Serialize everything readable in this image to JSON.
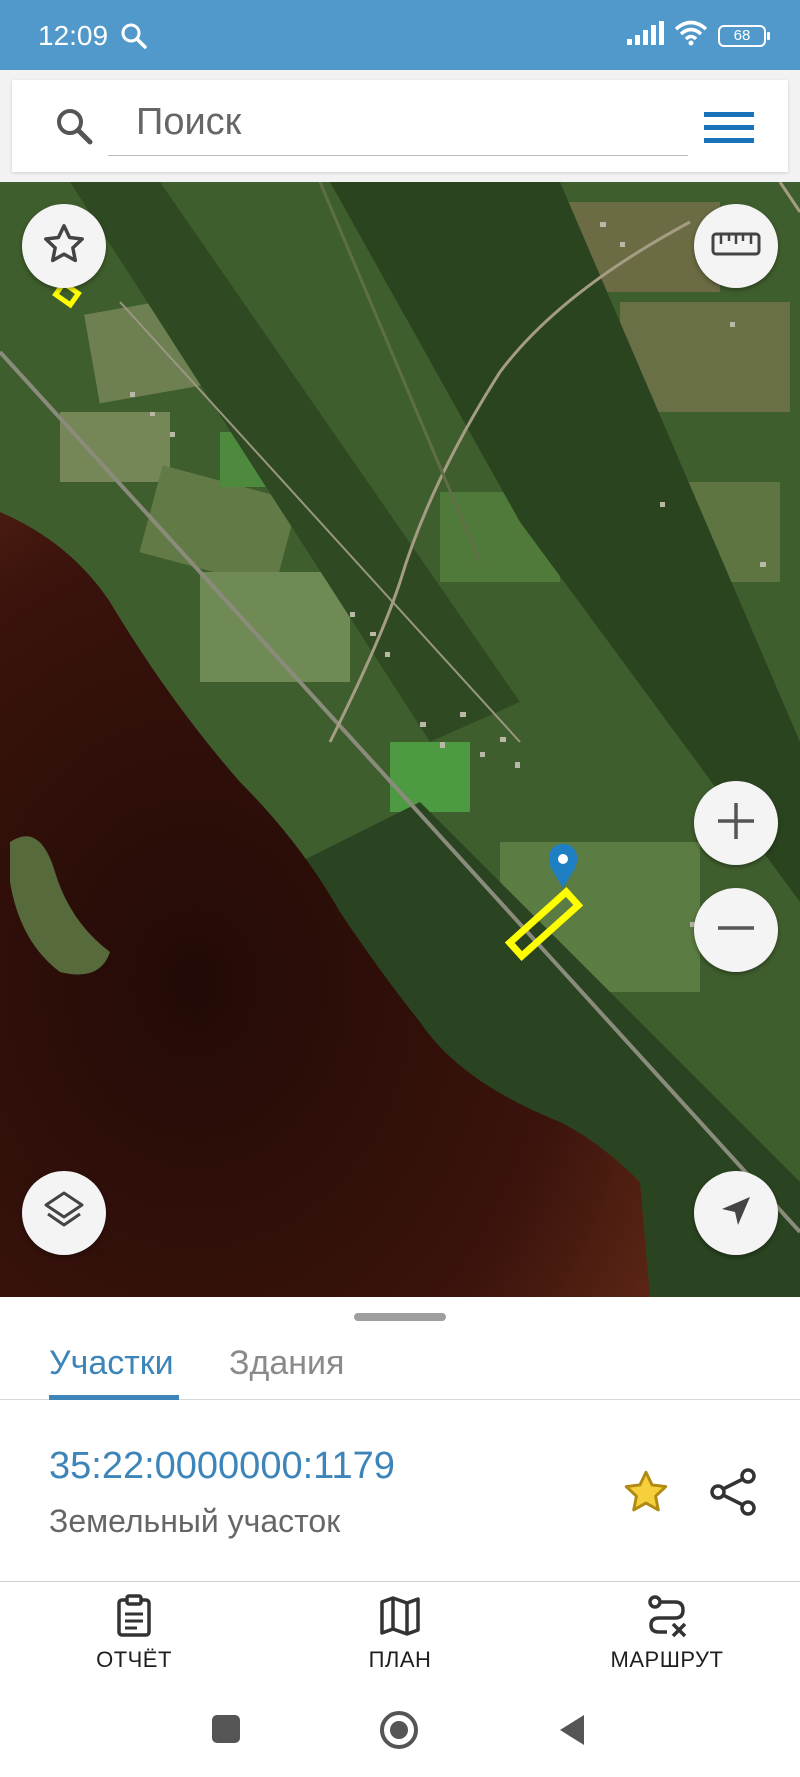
{
  "status_bar": {
    "time": "12:09",
    "battery": "68",
    "icons": [
      "search-icon",
      "signal-icon",
      "wifi-icon",
      "battery-icon"
    ]
  },
  "search": {
    "placeholder": "Поиск",
    "icons": [
      "search-icon",
      "menu-icon"
    ]
  },
  "map": {
    "controls": [
      "favorites-star-icon",
      "ruler-icon",
      "zoom-in-icon",
      "zoom-out-icon",
      "layers-icon",
      "locate-arrow-icon"
    ],
    "highlight_color": "#ffff00",
    "marker_color": "#1e7fc2"
  },
  "sheet": {
    "tabs": [
      {
        "label": "Участки",
        "active": true
      },
      {
        "label": "Здания",
        "active": false
      }
    ],
    "parcel": {
      "id": "35:22:0000000:1179",
      "type": "Земельный участок"
    },
    "accent_color": "#3d85b8",
    "star_color": "#d8b21a"
  },
  "actions": [
    {
      "label": "ОТЧЁТ",
      "icon": "report-clipboard-icon"
    },
    {
      "label": "ПЛАН",
      "icon": "map-plan-icon"
    },
    {
      "label": "МАРШРУТ",
      "icon": "route-icon"
    }
  ],
  "nav": [
    "recents-square-icon",
    "home-circle-icon",
    "back-triangle-icon"
  ]
}
